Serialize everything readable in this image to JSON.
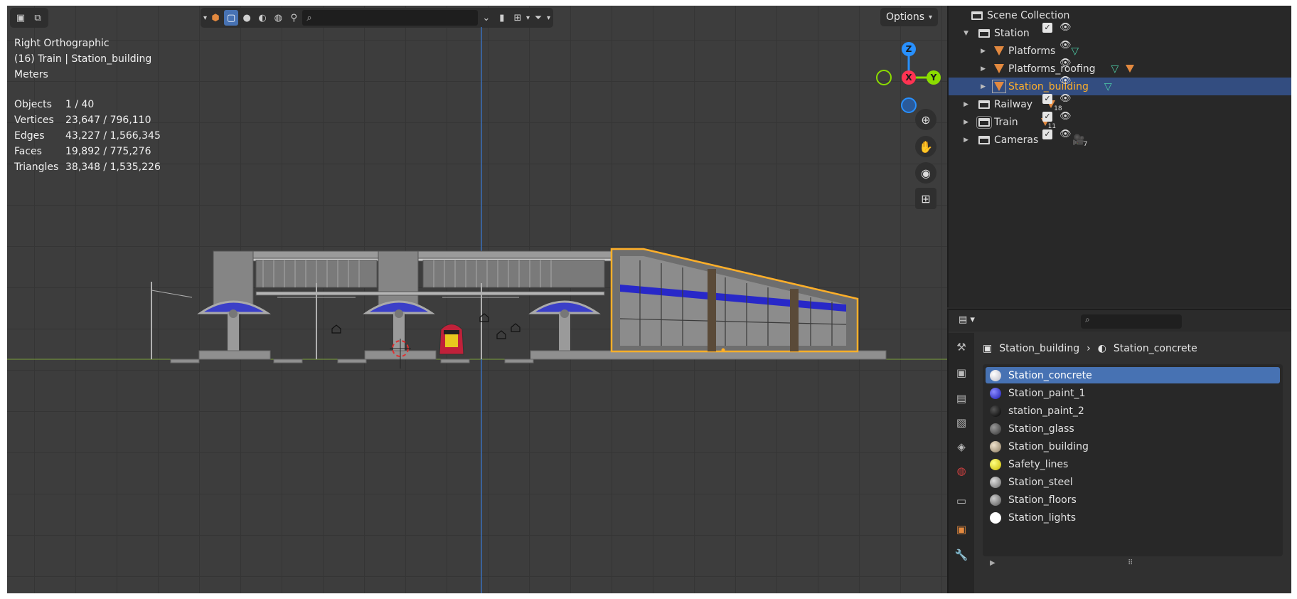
{
  "viewport": {
    "view_name": "Right Orthographic",
    "context": "(16) Train | Station_building",
    "units": "Meters",
    "options_label": "Options",
    "stats": [
      {
        "key": "Objects",
        "value": "1 / 40"
      },
      {
        "key": "Vertices",
        "value": "23,647 / 796,110"
      },
      {
        "key": "Edges",
        "value": "43,227 / 1,566,345"
      },
      {
        "key": "Faces",
        "value": "19,892 / 775,276"
      },
      {
        "key": "Triangles",
        "value": "38,348 / 1,535,226"
      }
    ],
    "gizmo": {
      "x": "X",
      "y": "Y",
      "z": "Z"
    },
    "colors": {
      "x_axis": "#ff3352",
      "y_axis": "#8bdc00",
      "z_axis": "#2890ff",
      "selection": "#ffaf29",
      "accent": "#4772b3"
    }
  },
  "outliner": {
    "scene_collection": "Scene Collection",
    "rows": [
      {
        "label": "Station"
      },
      {
        "label": "Platforms"
      },
      {
        "label": "Platforms_roofing"
      },
      {
        "label": "Station_building"
      },
      {
        "label": "Railway",
        "count": "18"
      },
      {
        "label": "Train",
        "count": "11"
      },
      {
        "label": "Cameras",
        "count": "7"
      }
    ]
  },
  "properties": {
    "breadcrumb_object": "Station_building",
    "breadcrumb_material": "Station_concrete",
    "materials": [
      {
        "name": "Station_concrete",
        "color": "#e8e8f0"
      },
      {
        "name": "Station_paint_1",
        "color": "#2f2fe0"
      },
      {
        "name": "station_paint_2",
        "color": "#111111"
      },
      {
        "name": "Station_glass",
        "color": "#555555"
      },
      {
        "name": "Station_building",
        "color": "#c7b8a0"
      },
      {
        "name": "Safety_lines",
        "color": "#f2ea1a"
      },
      {
        "name": "Station_steel",
        "color": "#9a9a9a"
      },
      {
        "name": "Station_floors",
        "color": "#8a8a8a"
      },
      {
        "name": "Station_lights",
        "color": "#ffffff"
      }
    ]
  }
}
